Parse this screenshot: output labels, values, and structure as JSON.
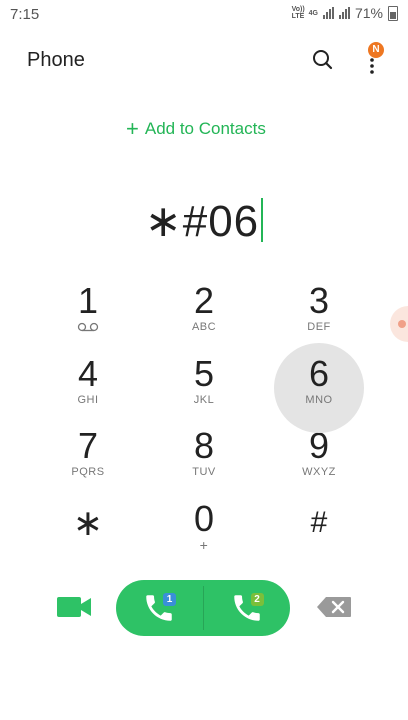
{
  "status_bar": {
    "time": "7:15",
    "volte_label": "Vo)) LTE",
    "network_label": "4G",
    "battery": "71%"
  },
  "app_bar": {
    "title": "Phone",
    "notification_badge": "N"
  },
  "add_contacts_label": "Add to Contacts",
  "dialed_number": "∗#06",
  "keypad": [
    {
      "digit": "1",
      "letters": "voicemail-icon"
    },
    {
      "digit": "2",
      "letters": "ABC"
    },
    {
      "digit": "3",
      "letters": "DEF"
    },
    {
      "digit": "4",
      "letters": "GHI"
    },
    {
      "digit": "5",
      "letters": "JKL"
    },
    {
      "digit": "6",
      "letters": "MNO"
    },
    {
      "digit": "7",
      "letters": "PQRS"
    },
    {
      "digit": "8",
      "letters": "TUV"
    },
    {
      "digit": "9",
      "letters": "WXYZ"
    },
    {
      "digit": "∗",
      "letters": ""
    },
    {
      "digit": "0",
      "letters": "+"
    },
    {
      "digit": "#",
      "letters": ""
    }
  ],
  "call_buttons": {
    "sim1_label": "1",
    "sim2_label": "2"
  },
  "colors": {
    "accent": "#23b556",
    "call_button": "#2ec266",
    "sim1": "#3a8fd8",
    "sim2": "#7bbf3a",
    "notification": "#ee7722"
  }
}
